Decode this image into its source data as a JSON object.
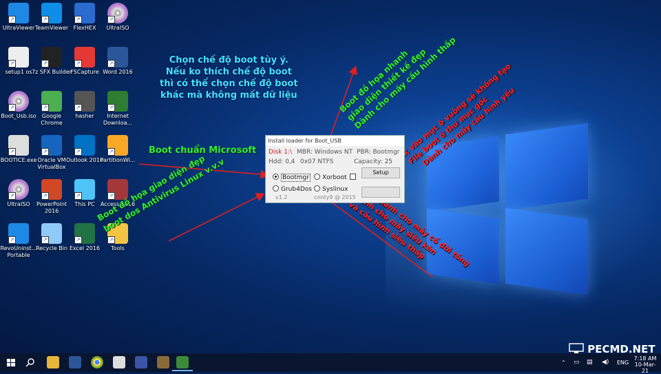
{
  "desktop_icons": [
    {
      "label": "UltraViewer",
      "icon": "ultraviewer-icon",
      "color": "#1e88e5"
    },
    {
      "label": "TeamViewer",
      "icon": "teamviewer-icon",
      "color": "#0e8ee9"
    },
    {
      "label": "FlexHEX",
      "icon": "flexhex-icon",
      "color": "#2a6bd0"
    },
    {
      "label": "UltraISO",
      "icon": "disc-icon",
      "color": "#cccccc"
    },
    {
      "label": "setup1 os",
      "icon": "setup-file-icon",
      "color": "#eeeeee"
    },
    {
      "label": "7z SFX Builder",
      "icon": "7z-icon",
      "color": "#222222"
    },
    {
      "label": "FSCapture",
      "icon": "fscapture-icon",
      "color": "#e53935"
    },
    {
      "label": "Word 2016",
      "icon": "word-icon",
      "color": "#2b579a"
    },
    {
      "label": "Boot_Usb.iso",
      "icon": "disc-icon",
      "color": "#cccccc"
    },
    {
      "label": "Google Chrome",
      "icon": "chrome-icon",
      "color": "#4caf50"
    },
    {
      "label": "hasher",
      "icon": "hasher-icon",
      "color": "#555555"
    },
    {
      "label": "Internet Downloa...",
      "icon": "idm-icon",
      "color": "#2e7d32"
    },
    {
      "label": "BOOTICE.exe",
      "icon": "bootice-icon",
      "color": "#dddddd"
    },
    {
      "label": "Oracle VM VirtualBox",
      "icon": "virtualbox-icon",
      "color": "#1565c0"
    },
    {
      "label": "Outlook 2016",
      "icon": "outlook-icon",
      "color": "#0072c6"
    },
    {
      "label": "PartitionWi...",
      "icon": "partitionwizard-icon",
      "color": "#f9a825"
    },
    {
      "label": "UltraISO",
      "icon": "disc-icon",
      "color": "#cccccc"
    },
    {
      "label": "PowerPoint 2016",
      "icon": "powerpoint-icon",
      "color": "#d24726"
    },
    {
      "label": "This PC",
      "icon": "computer-icon",
      "color": "#4fc3f7"
    },
    {
      "label": "Access 2016",
      "icon": "access-icon",
      "color": "#a4373a"
    },
    {
      "label": "RevoUninst... Portable",
      "icon": "revo-icon",
      "color": "#1e88e5"
    },
    {
      "label": "Recycle Bin",
      "icon": "recycle-bin-icon",
      "color": "#90caf9"
    },
    {
      "label": "Excel 2016",
      "icon": "excel-icon",
      "color": "#217346"
    },
    {
      "label": "Tools",
      "icon": "folder-icon",
      "color": "#f4c542"
    }
  ],
  "annotations": {
    "cyan_line1": "Chọn chế độ boot tùy ý.",
    "cyan_line2": "Nếu ko thích chế độ boot",
    "cyan_line3": "thì có thể chọn chế độ boot",
    "cyan_line4": "khác mà không mất dữ liệu",
    "boot_standard": "Boot chuẩn Microsoft",
    "grub_line1": "Boot đồ họa giao diện đẹp",
    "grub_line2": "boot dos Antivirus Linux v.v.v",
    "xor_line1": "Boot đồ họa nhanh",
    "xor_line2": "giao diện thiết kế đẹp",
    "xor_line3": "Dành cho máy cấu hình thấp",
    "check_line1": "Click vào mục ô vuông sẽ không tạo",
    "check_line2": "File boot ở thư mục gốc",
    "check_line3": "Dành cho máy cấu hình yếu",
    "sys_line1": "Boot dành cho máy cổ đời tống",
    "sys_line2": "Dành cho máy siêu kén",
    "sys_line3": "và cấu hình siêu thấp"
  },
  "dialog": {
    "title": "Install loader for Boot_USB",
    "disk": "Disk 1:\\",
    "mbr": "MBR: Windows NT",
    "pbr": "PBR: Bootmgr",
    "hdd": "Hdd: 0,4",
    "partition": "0x07 NTFS",
    "capacity": "Capacity: 25",
    "opt_bootmgr": "Bootmgr",
    "opt_xorboot": "Xorboot",
    "opt_grub4dos": "Grub4Dos",
    "opt_syslinux": "Syslinux",
    "setup_label": "Setup",
    "version": "v1.2",
    "author": "conty9 @ 2015",
    "selected": "Bootmgr"
  },
  "taskbar": {
    "apps": [
      "start-icon",
      "search-icon",
      "file-explorer-icon",
      "word-icon",
      "chrome-icon",
      "app-icon",
      "network-icon",
      "app-icon",
      "bootusb-icon"
    ],
    "time": "7:18 AM",
    "date": "10-Mar-21",
    "language": "ENG"
  },
  "watermark": "PECMD.NET"
}
